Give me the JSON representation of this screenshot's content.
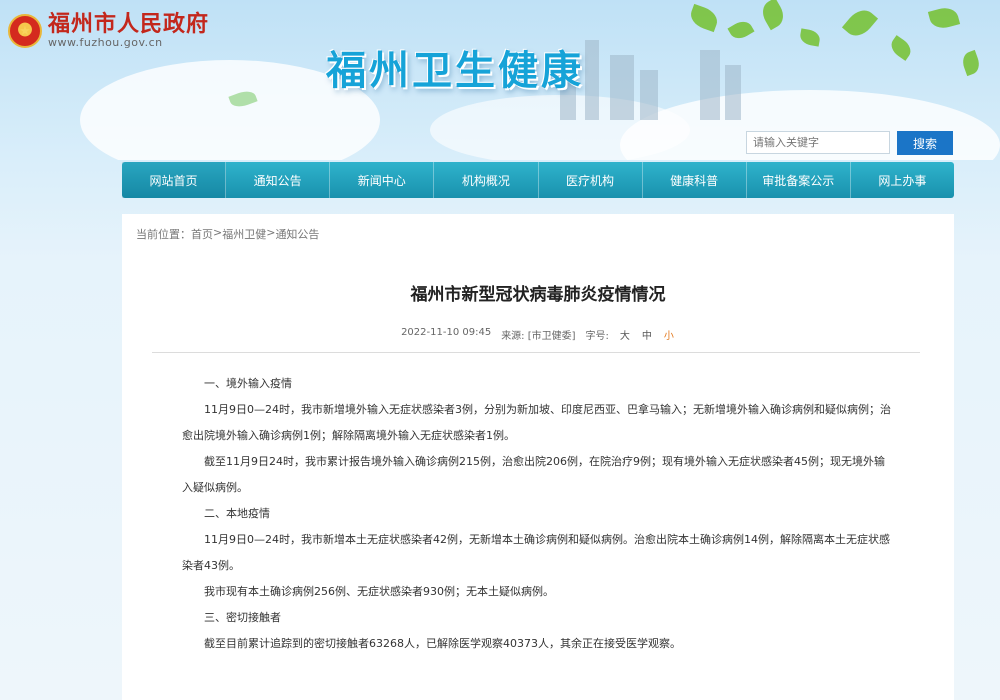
{
  "header": {
    "gov_name": "福州市人民政府",
    "gov_url": "www.fuzhou.gov.cn",
    "emblem_icon": "national-emblem-icon",
    "site_title": "福州卫生健康",
    "search": {
      "placeholder": "请输入关键字",
      "button": "搜索"
    }
  },
  "nav": {
    "items": [
      "网站首页",
      "通知公告",
      "新闻中心",
      "机构概况",
      "医疗机构",
      "健康科普",
      "审批备案公示",
      "网上办事"
    ],
    "active_index": 0
  },
  "breadcrumb": {
    "prefix": "当前位置：",
    "items": [
      "首页",
      "福州卫健",
      "通知公告"
    ],
    "separator": ">"
  },
  "article": {
    "title": "福州市新型冠状病毒肺炎疫情情况",
    "date": "2022-11-10 09:45",
    "source": "来源: [市卫健委]",
    "font_size_label": "字号:",
    "font_sizes": [
      "大",
      "中",
      "小"
    ],
    "paragraphs": [
      "一、境外输入疫情",
      "11月9日0—24时，我市新增境外输入无症状感染者3例，分别为新加坡、印度尼西亚、巴拿马输入；无新增境外输入确诊病例和疑似病例；治愈出院境外输入确诊病例1例；解除隔离境外输入无症状感染者1例。",
      "截至11月9日24时，我市累计报告境外输入确诊病例215例，治愈出院206例，在院治疗9例；现有境外输入无症状感染者45例；现无境外输入疑似病例。",
      "二、本地疫情",
      "11月9日0—24时，我市新增本土无症状感染者42例，无新增本土确诊病例和疑似病例。治愈出院本土确诊病例14例，解除隔离本土无症状感染者43例。",
      "我市现有本土确诊病例256例、无症状感染者930例；无本土疑似病例。",
      "三、密切接触者",
      "截至目前累计追踪到的密切接触者63268人，已解除医学观察40373人，其余正在接受医学观察。"
    ]
  },
  "colors": {
    "nav_bg": "#1fa2bd",
    "search_btn": "#1b75c7",
    "site_title": "#16a3d8",
    "gov_name": "#c3271c",
    "font_small_active": "#e37a1f"
  }
}
